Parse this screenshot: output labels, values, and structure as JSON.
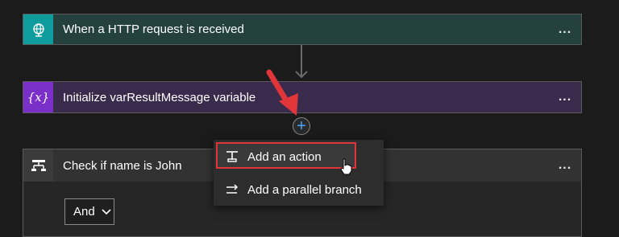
{
  "flow": {
    "trigger": {
      "title": "When a HTTP request is received",
      "more": "..."
    },
    "init_variable": {
      "title": "Initialize varResultMessage variable",
      "icon_text": "{x}",
      "more": "..."
    },
    "condition": {
      "title": "Check if name is John",
      "more": "...",
      "operator": "And"
    }
  },
  "add_button": {
    "label": "+"
  },
  "context_menu": {
    "items": [
      {
        "label": "Add an action"
      },
      {
        "label": "Add a parallel branch"
      }
    ]
  },
  "colors": {
    "trigger_accent": "#0f9c9c",
    "variable_accent": "#7a2fc8",
    "highlight_box": "#e0363a",
    "annotation_arrow": "#e0363a",
    "plus_color": "#4aa3ff"
  }
}
